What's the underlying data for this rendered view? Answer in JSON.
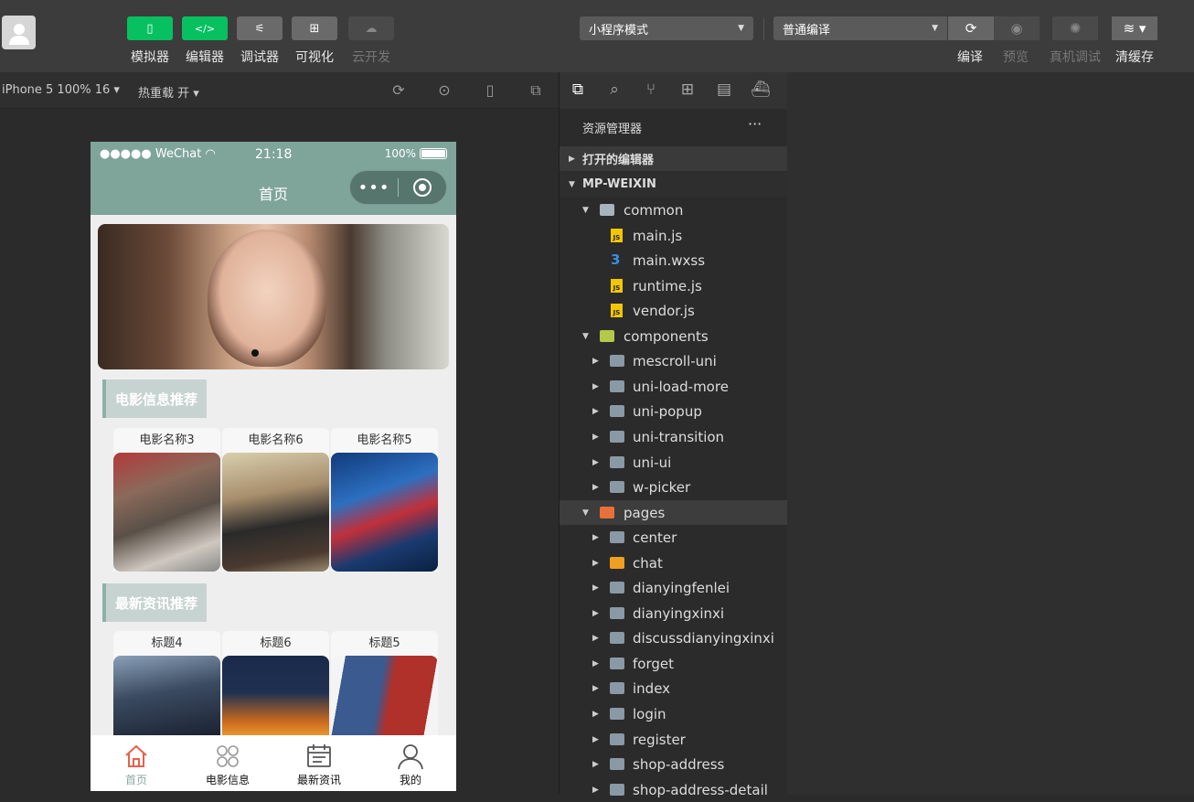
{
  "toolbar": {
    "buttons": [
      {
        "label": "模拟器",
        "icon": "phone-icon",
        "color": "#07c160"
      },
      {
        "label": "编辑器",
        "icon": "code-icon",
        "color": "#07c160"
      },
      {
        "label": "调试器",
        "icon": "sliders-icon",
        "color": "#6a6a6a"
      },
      {
        "label": "可视化",
        "icon": "layout-icon",
        "color": "#6a6a6a"
      },
      {
        "label": "云开发",
        "icon": "cloud-icon",
        "color": "#4a4a4a"
      }
    ],
    "mode_select": "小程序模式",
    "compile_select": "普通编译",
    "right_buttons": [
      {
        "label": "编译",
        "icon": "refresh-icon"
      },
      {
        "label": "预览",
        "icon": "eye-icon"
      },
      {
        "label": "真机调试",
        "icon": "bug-icon"
      },
      {
        "label": "清缓存",
        "icon": "layers-icon"
      }
    ]
  },
  "simulator_bar": {
    "device": "iPhone 5 100% 16",
    "hot_reload": "热重载 开"
  },
  "phone": {
    "status": {
      "signal": "●●●●● WeChat",
      "time": "21:18",
      "battery": "100%"
    },
    "nav_title": "首页",
    "sections": [
      {
        "title": "电影信息推荐",
        "cards": [
          "电影名称3",
          "电影名称6",
          "电影名称5"
        ]
      },
      {
        "title": "最新资讯推荐",
        "cards": [
          "标题4",
          "标题6",
          "标题5"
        ]
      }
    ],
    "tabs": [
      {
        "label": "首页",
        "icon": "home-icon",
        "active": true
      },
      {
        "label": "电影信息",
        "icon": "grid-icon",
        "active": false
      },
      {
        "label": "最新资讯",
        "icon": "calendar-icon",
        "active": false
      },
      {
        "label": "我的",
        "icon": "user-icon",
        "active": false
      }
    ]
  },
  "explorer": {
    "title": "资源管理器",
    "open_editors": "打开的编辑器",
    "project": "MP-WEIXIN",
    "tree": [
      {
        "name": "common",
        "type": "folder-open",
        "depth": 1,
        "expanded": true
      },
      {
        "name": "main.js",
        "type": "js",
        "depth": 2
      },
      {
        "name": "main.wxss",
        "type": "css",
        "depth": 2
      },
      {
        "name": "runtime.js",
        "type": "js",
        "depth": 2
      },
      {
        "name": "vendor.js",
        "type": "js",
        "depth": 2
      },
      {
        "name": "components",
        "type": "folder-special",
        "depth": 1,
        "expanded": true
      },
      {
        "name": "mescroll-uni",
        "type": "folder",
        "depth": 2
      },
      {
        "name": "uni-load-more",
        "type": "folder",
        "depth": 2
      },
      {
        "name": "uni-popup",
        "type": "folder",
        "depth": 2
      },
      {
        "name": "uni-transition",
        "type": "folder",
        "depth": 2
      },
      {
        "name": "uni-ui",
        "type": "folder",
        "depth": 2
      },
      {
        "name": "w-picker",
        "type": "folder",
        "depth": 2
      },
      {
        "name": "pages",
        "type": "folder-pages",
        "depth": 1,
        "expanded": true,
        "highlight": true
      },
      {
        "name": "center",
        "type": "folder",
        "depth": 2
      },
      {
        "name": "chat",
        "type": "folder-chat",
        "depth": 2
      },
      {
        "name": "dianyingfenlei",
        "type": "folder",
        "depth": 2
      },
      {
        "name": "dianyingxinxi",
        "type": "folder",
        "depth": 2
      },
      {
        "name": "discussdianyingxinxi",
        "type": "folder",
        "depth": 2
      },
      {
        "name": "forget",
        "type": "folder",
        "depth": 2
      },
      {
        "name": "index",
        "type": "folder",
        "depth": 2
      },
      {
        "name": "login",
        "type": "folder",
        "depth": 2
      },
      {
        "name": "register",
        "type": "folder",
        "depth": 2
      },
      {
        "name": "shop-address",
        "type": "folder",
        "depth": 2
      },
      {
        "name": "shop-address-detail",
        "type": "folder",
        "depth": 2
      }
    ]
  }
}
